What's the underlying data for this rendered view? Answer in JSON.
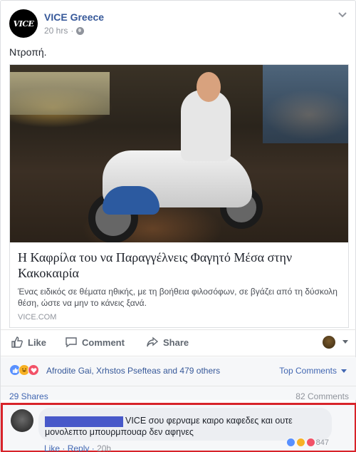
{
  "post": {
    "page_name": "VICE Greece",
    "avatar_text": "VICE",
    "time": "20 hrs",
    "privacy_icon": "globe-icon",
    "text": "Ντροπή."
  },
  "link": {
    "title": "Η Καφρίλα του να Παραγγέλνεις Φαγητό Μέσα στην Κακοκαιρία",
    "description": "Ένας ειδικός σε θέματα ηθικής, με τη βοήθεια φιλοσόφων, σε βγάζει από τη δύσκολη θέση, ώστε να μην το κάνεις ξανά.",
    "domain": "VICE.COM"
  },
  "actions": {
    "like": "Like",
    "comment": "Comment",
    "share": "Share"
  },
  "reactions": {
    "names": "Afrodite Gai, Xrhstos Psefteas and 479 others",
    "top_comments": "Top Comments",
    "shares": "29 Shares",
    "comments": "82 Comments"
  },
  "comment": {
    "text_line1": "VICE σου φερναμε καιρο καφεδες και ουτε",
    "text_line2": "μονολεπτο μπουρμπουαρ δεν αφηνες",
    "reaction_count": "847",
    "like": "Like",
    "reply": "Reply",
    "time": "20h"
  },
  "colors": {
    "link_blue": "#365899",
    "highlight_border": "#d8232a",
    "redaction": "#4758c9"
  }
}
